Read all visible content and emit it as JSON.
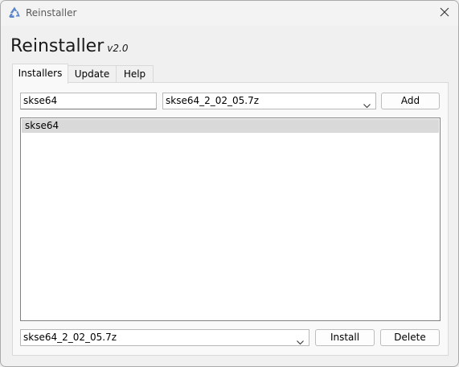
{
  "window": {
    "title": "Reinstaller"
  },
  "heading": {
    "name": "Reinstaller",
    "version": "v2.0"
  },
  "tabs": [
    {
      "label": "Installers",
      "active": true
    },
    {
      "label": "Update",
      "active": false
    },
    {
      "label": "Help",
      "active": false
    }
  ],
  "installers": {
    "name_input_value": "skse64",
    "archive_select_value": "skse64_2_02_05.7z",
    "add_label": "Add",
    "list_items": [
      "skse64"
    ],
    "bottom_select_value": "skse64_2_02_05.7z",
    "install_label": "Install",
    "delete_label": "Delete"
  },
  "colors": {
    "selection": "#d9d9d9",
    "icon_blue": "#5b86c9"
  },
  "icons": {
    "app": "recycle-icon",
    "close": "close-icon",
    "dropdown": "chevron-down-icon"
  }
}
